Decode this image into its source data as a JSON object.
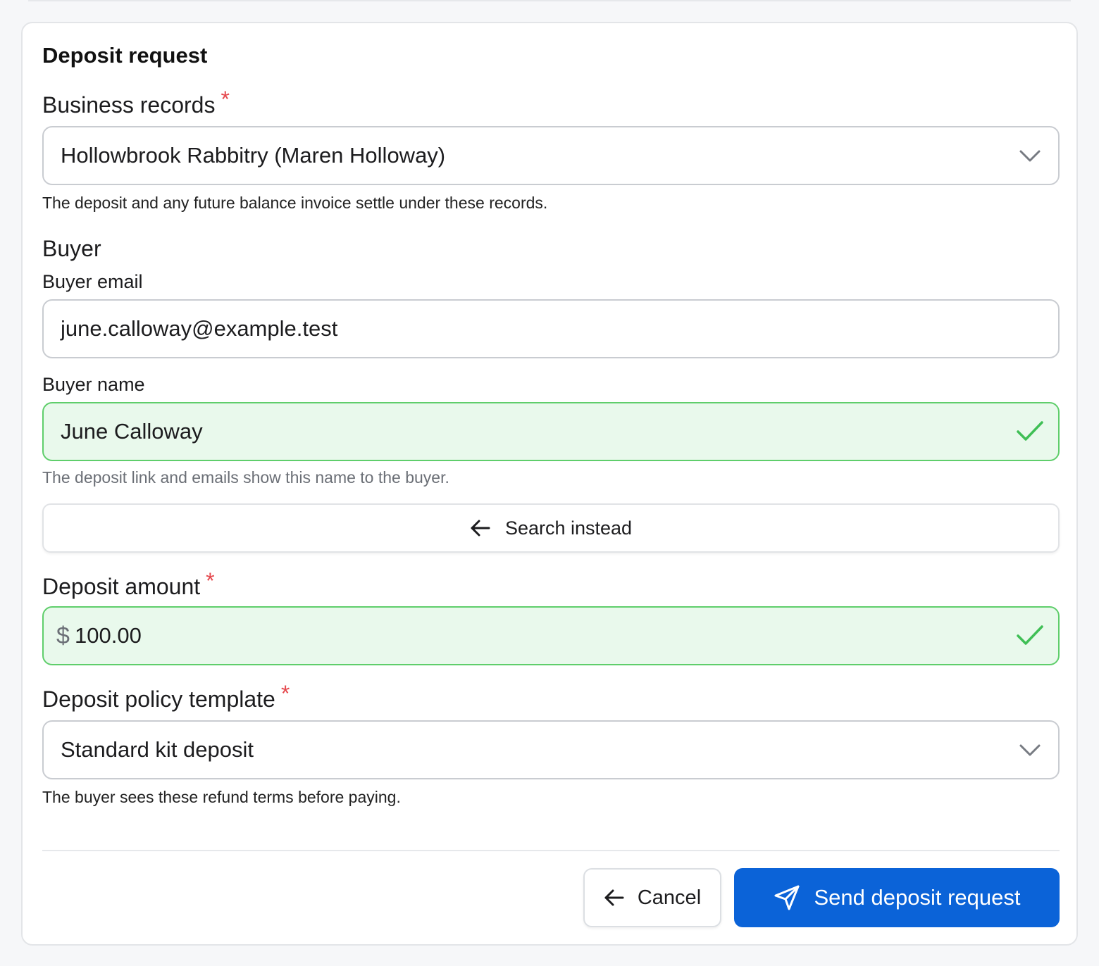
{
  "form": {
    "title": "Deposit request",
    "business_records": {
      "label": "Business records",
      "required_mark": "*",
      "value": "Hollowbrook Rabbitry (Maren Holloway)",
      "help": "The deposit and any future balance invoice settle under these records."
    },
    "buyer": {
      "section_label": "Buyer",
      "email_label": "Buyer email",
      "email_value": "june.calloway@example.test",
      "name_label": "Buyer name",
      "name_value": "June Calloway",
      "name_help": "The deposit link and emails show this name to the buyer.",
      "search_instead_label": "Search instead"
    },
    "deposit_amount": {
      "label": "Deposit amount",
      "required_mark": "*",
      "currency": "$",
      "value": "100.00"
    },
    "policy_template": {
      "label": "Deposit policy template",
      "required_mark": "*",
      "value": "Standard kit deposit",
      "help": "The buyer sees these refund terms before paying."
    }
  },
  "actions": {
    "cancel_label": "Cancel",
    "send_label": "Send deposit request"
  },
  "colors": {
    "primary": "#0b63d8",
    "valid_border": "#5fce6b",
    "valid_bg": "#e9f9ec",
    "required": "#e5484d"
  },
  "icons": {
    "select": "chevron-down-icon",
    "valid": "check-icon",
    "back": "arrow-left-icon",
    "send": "send-icon"
  }
}
